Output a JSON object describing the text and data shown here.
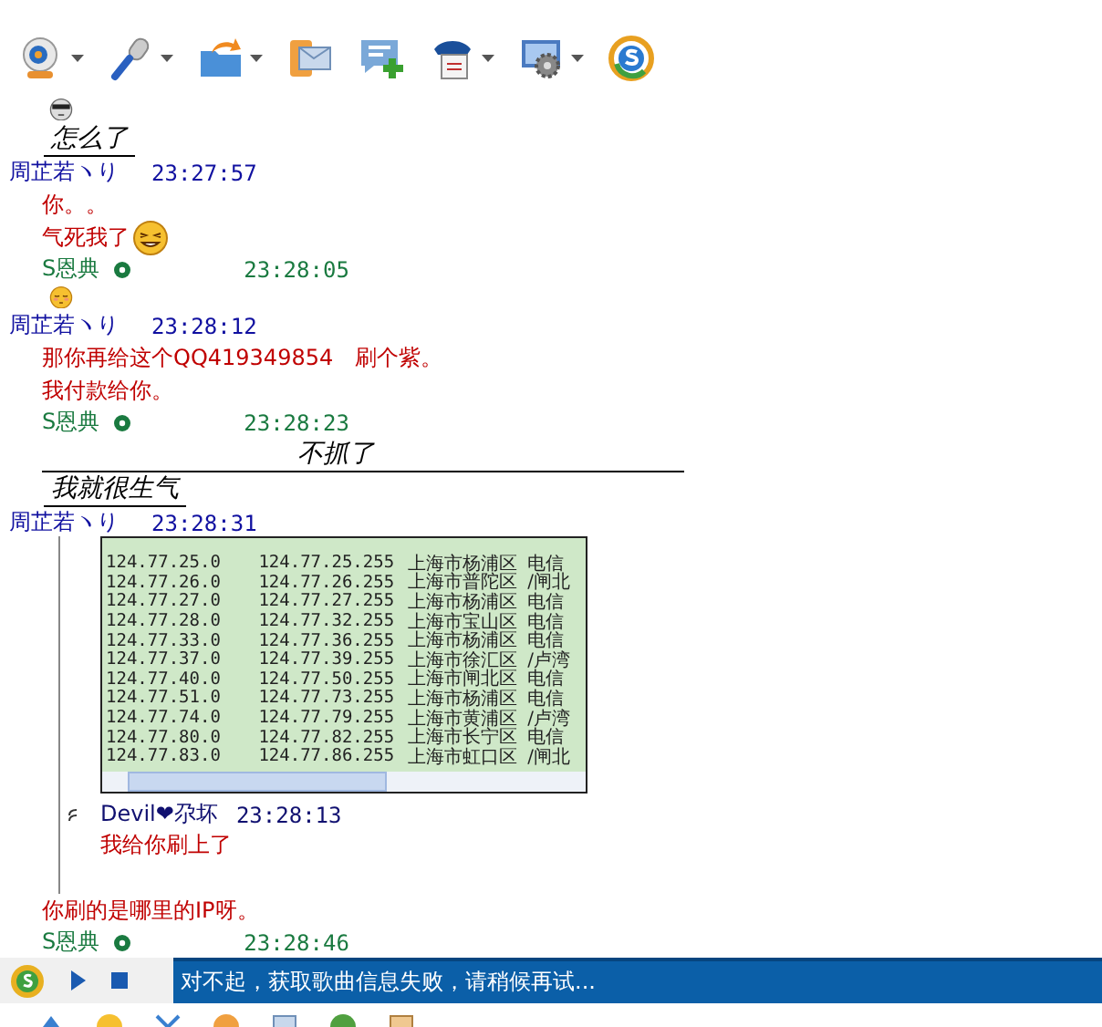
{
  "toolbar": [
    {
      "kind": "webcam",
      "dropdown": true
    },
    {
      "kind": "microphone",
      "dropdown": true
    },
    {
      "kind": "folder",
      "dropdown": true
    },
    {
      "kind": "mail",
      "dropdown": false
    },
    {
      "kind": "chat_add",
      "dropdown": false
    },
    {
      "kind": "officer",
      "dropdown": true
    },
    {
      "kind": "monitor",
      "dropdown": true
    },
    {
      "kind": "logo",
      "dropdown": false
    }
  ],
  "messages": [
    {
      "kind": "emoticon",
      "emoticon": {
        "kind": "sunglasses"
      }
    },
    {
      "kind": "art",
      "text": "怎么了"
    },
    {
      "kind": "incoming",
      "sender": "周芷若ヽり",
      "time": "23:27:57",
      "color": "#1010a0"
    },
    {
      "kind": "text",
      "text": "你。。"
    },
    {
      "kind": "text",
      "text": "气死我了",
      "emoticon": {
        "kind": "grin"
      }
    },
    {
      "kind": "outgoing",
      "sender": "S恩典",
      "time": "23:28:05",
      "color": "#1a7a40"
    },
    {
      "kind": "emoticon",
      "emoticon": {
        "kind": "sleepy"
      }
    },
    {
      "kind": "incoming",
      "sender": "周芷若ヽり",
      "time": "23:28:12",
      "color": "#1010a0"
    },
    {
      "kind": "text",
      "text": "那你再给这个QQ419349854　刷个紫。"
    },
    {
      "kind": "text",
      "text": "我付款给你。"
    },
    {
      "kind": "outgoing",
      "sender": "S恩典",
      "time": "23:28:23",
      "color": "#1a7a40"
    },
    {
      "kind": "ruled_art",
      "text": "不抓了"
    },
    {
      "kind": "art",
      "text": "我就很生气"
    },
    {
      "kind": "incoming",
      "sender": "周芷若ヽり",
      "time": "23:28:31",
      "color": "#1010a0"
    },
    {
      "kind": "quote",
      "table": [
        [
          "124.77.25.0",
          "124.77.25.255",
          "上海市杨浦区",
          "电信"
        ],
        [
          "124.77.26.0",
          "124.77.26.255",
          "上海市普陀区",
          "/闸北"
        ],
        [
          "124.77.27.0",
          "124.77.27.255",
          "上海市杨浦区",
          "电信"
        ],
        [
          "124.77.28.0",
          "124.77.32.255",
          "上海市宝山区",
          "电信"
        ],
        [
          "124.77.33.0",
          "124.77.36.255",
          "上海市杨浦区",
          "电信"
        ],
        [
          "124.77.37.0",
          "124.77.39.255",
          "上海市徐汇区",
          "/卢湾"
        ],
        [
          "124.77.40.0",
          "124.77.50.255",
          "上海市闸北区",
          "电信"
        ],
        [
          "124.77.51.0",
          "124.77.73.255",
          "上海市杨浦区",
          "电信"
        ],
        [
          "124.77.74.0",
          "124.77.79.255",
          "上海市黄浦区",
          "/卢湾"
        ],
        [
          "124.77.80.0",
          "124.77.82.255",
          "上海市长宁区",
          "电信"
        ],
        [
          "124.77.83.0",
          "124.77.86.255",
          "上海市虹口区",
          "/闸北"
        ]
      ],
      "sender": "Devil❤尕坏",
      "time": "23:28:13",
      "text": "我给你刷上了"
    },
    {
      "kind": "text",
      "text": "你刷的是哪里的IP呀。"
    },
    {
      "kind": "outgoing",
      "sender": "S恩典",
      "time": "23:28:46",
      "color": "#1a7a40"
    }
  ],
  "music_bar": {
    "status": "对不起，获取歌曲信息失败，请稍候再试..."
  }
}
